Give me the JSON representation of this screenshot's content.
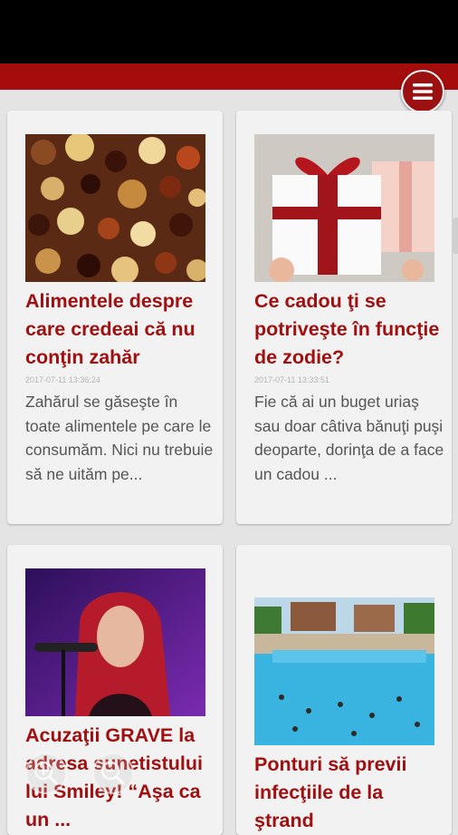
{
  "articles": [
    {
      "title": "Alimentele despre care credeai că nu conţin zahăr",
      "date": "2017-07-11 13:36:24",
      "excerpt": "Zahărul se găseşte în toate alimentele pe care le consumăm. Nici nu trebuie să ne uităm pe..."
    },
    {
      "title": "Ce cadou ţi se potriveşte în funcţie de zodie?",
      "date": "2017-07-11 13:33:51",
      "excerpt": "Fie că ai un buget uriaş sau doar câtiva bănuţi puşi deoparte, dorinţa de a face un cadou ..."
    },
    {
      "title": "Acuzaţii GRAVE la adresa sunetis­tului lui Smiley! “Aşa ca un ...",
      "date": "",
      "excerpt": ""
    },
    {
      "title": "Ponturi să previi infecţiile de la ştrand",
      "date": "",
      "excerpt": ""
    }
  ],
  "icons": {
    "menu": "hamburger-menu-icon",
    "zoom_in": "zoom-in-icon",
    "zoom_out": "zoom-out-icon"
  },
  "colors": {
    "brand": "#a50d0d",
    "title": "#a01010",
    "card": "#f2f2f2",
    "background": "#e4e4e4"
  }
}
